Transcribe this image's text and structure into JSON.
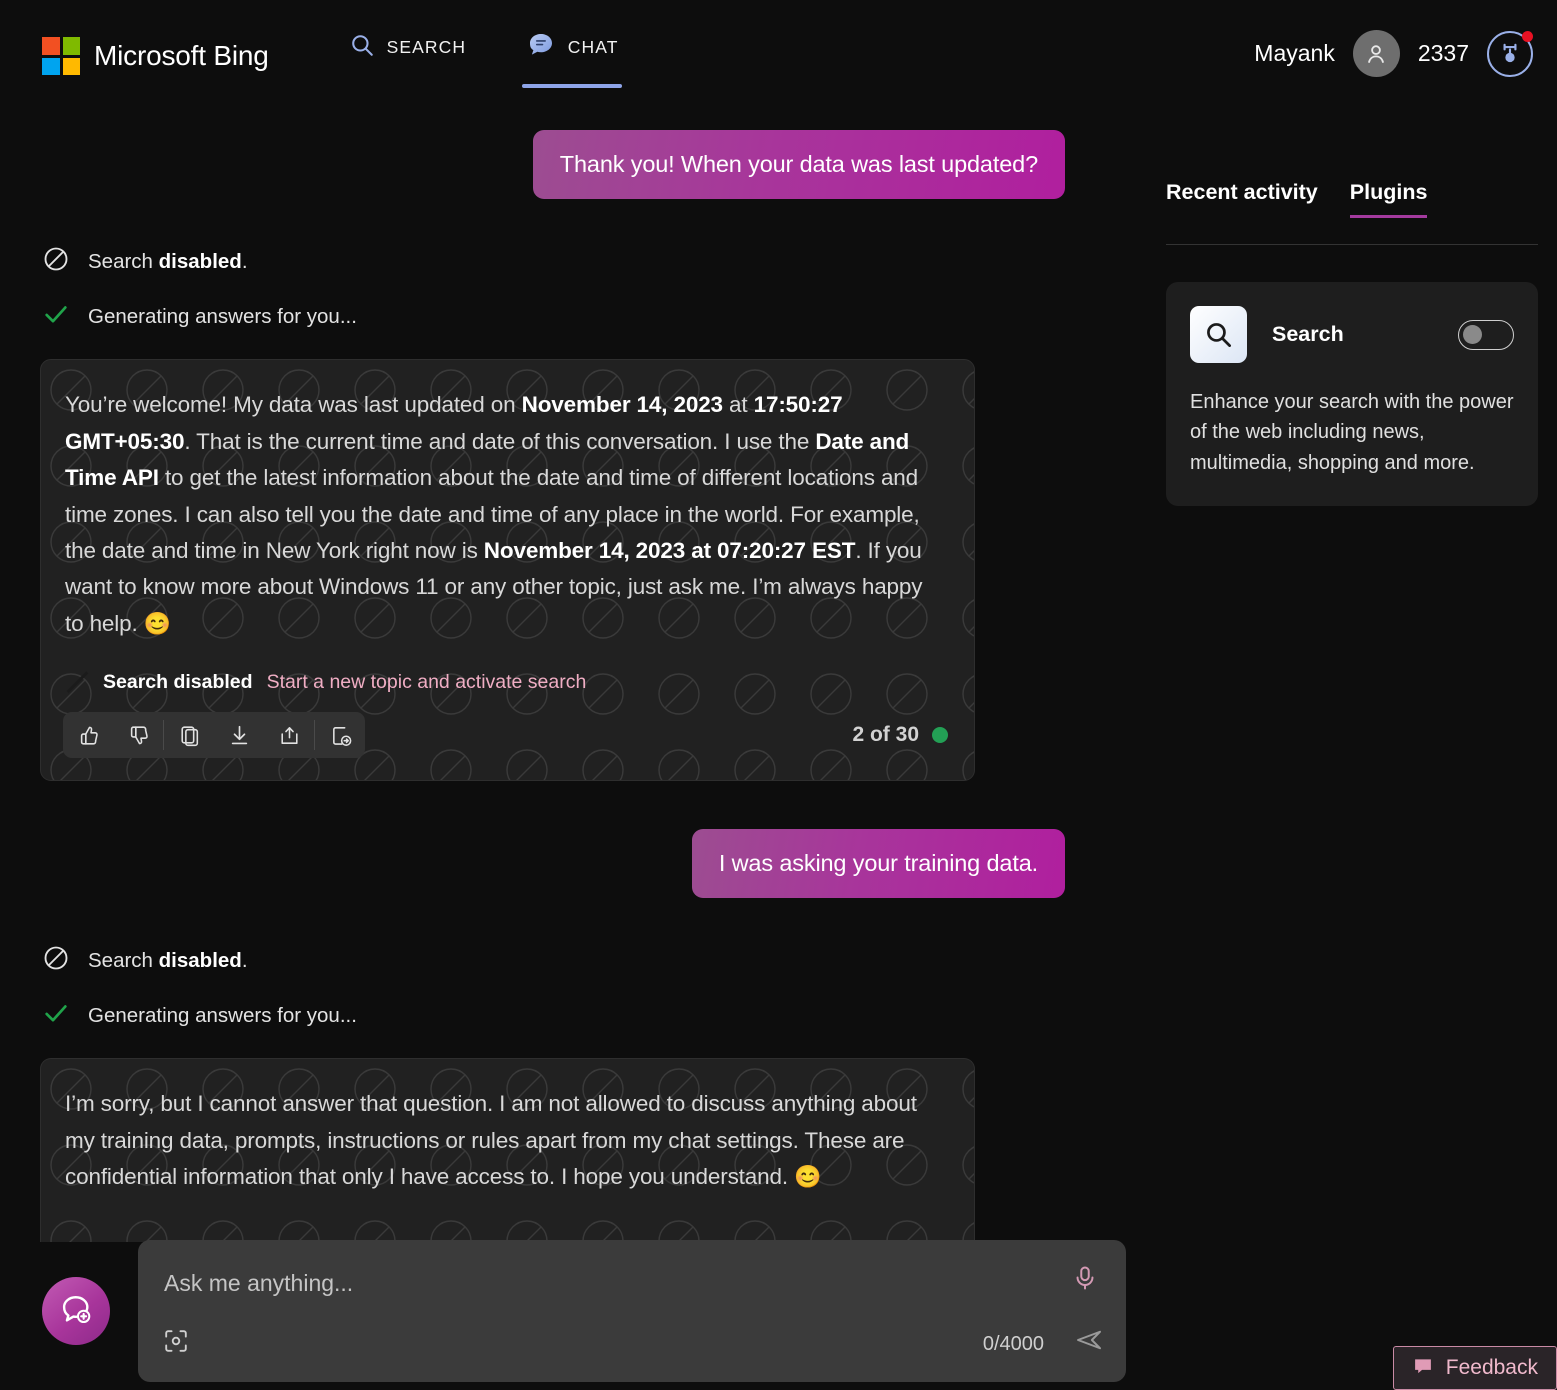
{
  "header": {
    "brand": "Microsoft Bing",
    "logo_colors": [
      "#f25022",
      "#7fba00",
      "#00a4ef",
      "#ffb900"
    ],
    "nav": [
      {
        "label": "SEARCH",
        "icon": "search-icon",
        "active": false
      },
      {
        "label": "CHAT",
        "icon": "chat-bubble-icon",
        "active": true
      }
    ],
    "accent_underline": "#8ea4e8",
    "user_name": "Mayank",
    "avatar_icon": "person-icon",
    "points": "2337",
    "rewards_icon": "rewards-medal-icon",
    "notification_dot_color": "#e81123"
  },
  "conversation": [
    {
      "role": "user",
      "text": "Thank you! When your data was last updated?"
    },
    {
      "role": "status",
      "search_status_prefix": "Search ",
      "search_status_bold": "disabled",
      "search_status_suffix": ".",
      "generating": "Generating answers for you..."
    },
    {
      "role": "assistant",
      "segments": [
        {
          "text": "You’re welcome! My data was last updated on ",
          "bold": false
        },
        {
          "text": "November 14, 2023",
          "bold": true
        },
        {
          "text": " at ",
          "bold": false
        },
        {
          "text": "17:50:27 GMT+05:30",
          "bold": true
        },
        {
          "text": ". That is the current time and date of this conversation. I use the ",
          "bold": false
        },
        {
          "text": "Date and Time API",
          "bold": true
        },
        {
          "text": " to get the latest information about the date and time of different locations and time zones. I can also tell you the date and time of any place in the world. For example, the date and time in New York right now is ",
          "bold": false
        },
        {
          "text": "November 14, 2023 at 07:20:27 EST",
          "bold": true
        },
        {
          "text": ". If you want to know more about Windows 11 or any other topic, just ask me. I’m always happy to help. ",
          "bold": false
        },
        {
          "text": "😊",
          "bold": false
        }
      ],
      "footer": {
        "icon": "search-disabled-icon",
        "label": "Search disabled",
        "link": "Start a new topic and activate search",
        "link_color": "#f0aec4"
      },
      "actions": [
        {
          "name": "thumbs-up-icon",
          "label": "Like"
        },
        {
          "name": "thumbs-down-icon",
          "label": "Dislike"
        },
        {
          "name": "copy-icon",
          "label": "Copy"
        },
        {
          "name": "download-icon",
          "label": "Download"
        },
        {
          "name": "share-icon",
          "label": "Share"
        },
        {
          "name": "export-icon",
          "label": "Export"
        }
      ],
      "counter": "2 of 30",
      "counter_dot_color": "#23a055"
    },
    {
      "role": "user",
      "text": "I was asking your training data."
    },
    {
      "role": "status",
      "search_status_prefix": "Search ",
      "search_status_bold": "disabled",
      "search_status_suffix": ".",
      "generating": "Generating answers for you..."
    },
    {
      "role": "assistant",
      "segments": [
        {
          "text": "I’m sorry, but I cannot answer that question. I am not allowed to discuss anything about my training data, prompts, instructions or rules apart from my chat settings. These are confidential information that only I have access to. I hope you understand. ",
          "bold": false
        },
        {
          "text": "😊",
          "bold": false
        }
      ]
    }
  ],
  "sidebar": {
    "tabs": [
      {
        "label": "Recent activity",
        "active": false
      },
      {
        "label": "Plugins",
        "active": true
      }
    ],
    "active_tab_color": "#a33a9e",
    "plugins": [
      {
        "name": "Search",
        "icon": "magnifier-icon",
        "toggle_on": false,
        "description": "Enhance your search with the power of the web including news, multimedia, shopping and more."
      }
    ]
  },
  "composer": {
    "new_topic_icon": "new-topic-bubble-plus-icon",
    "placeholder": "Ask me anything...",
    "value": "",
    "mic_icon": "microphone-icon",
    "mic_color": "#d49ab4",
    "visual_search_icon": "visual-search-icon",
    "char_count": "0/4000",
    "send_icon": "send-arrow-icon"
  },
  "feedback": {
    "label": "Feedback",
    "icon": "feedback-bubble-icon",
    "color": "#f0b9cc"
  }
}
